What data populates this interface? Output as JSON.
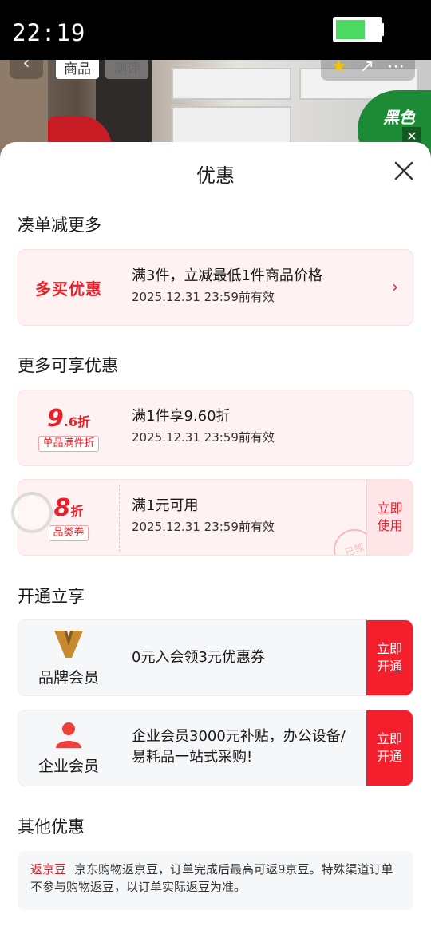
{
  "status_bar": {
    "time": "22:19"
  },
  "background": {
    "tabs": [
      "商品",
      "测评"
    ],
    "badge_text": "黑色"
  },
  "sheet": {
    "title": "优惠",
    "sections": {
      "combine": "凑单减更多",
      "more": "更多可享优惠",
      "open": "开通立享",
      "other": "其他优惠"
    },
    "multi_buy": {
      "tag": "多买优惠",
      "line1": "满3件，立减最低1件商品价格",
      "line2": "2025.12.31 23:59前有效"
    },
    "coupon_96": {
      "num_big": "9",
      "num_small": ".6",
      "unit": "折",
      "tag": "单品满件折",
      "line1": "满1件享9.60折",
      "line2": "2025.12.31 23:59前有效"
    },
    "coupon_8": {
      "num_big": "8",
      "unit": "折",
      "tag": "品类券",
      "line1": "满1元可用",
      "line2": "2025.12.31 23:59前有效",
      "button": "立即使用",
      "stamp": "已领"
    },
    "brand_member": {
      "name": "品牌会员",
      "text": "0元入会领3元优惠券",
      "button": "立即开通"
    },
    "enterprise_member": {
      "name": "企业会员",
      "text": "企业会员3000元补贴，办公设备/易耗品一站式采购!",
      "button": "立即开通"
    },
    "jd_bean": {
      "tag": "返京豆",
      "text": "京东购物返京豆，订单完成后最高可返9京豆。特殊渠道订单不参与购物返豆，以订单实际返豆为准。"
    }
  },
  "colors": {
    "accent": "#e8202a",
    "brand_gold": "#c88a2e"
  }
}
